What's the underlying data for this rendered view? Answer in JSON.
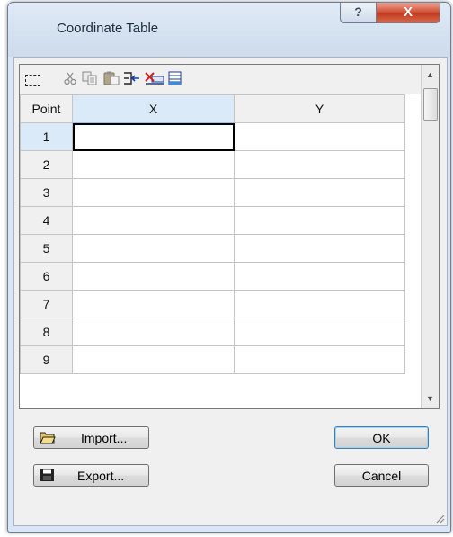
{
  "window": {
    "title": "Coordinate Table",
    "help_label": "?",
    "close_label": "X"
  },
  "toolbar": {
    "items": [
      "select-all-icon",
      "cut-icon",
      "copy-icon",
      "paste-icon",
      "insert-row-icon",
      "delete-row-icon",
      "append-row-icon"
    ]
  },
  "grid": {
    "headers": [
      "Point",
      "X",
      "Y"
    ],
    "rows": [
      {
        "point": "1",
        "x": "",
        "y": ""
      },
      {
        "point": "2",
        "x": "",
        "y": ""
      },
      {
        "point": "3",
        "x": "",
        "y": ""
      },
      {
        "point": "4",
        "x": "",
        "y": ""
      },
      {
        "point": "5",
        "x": "",
        "y": ""
      },
      {
        "point": "6",
        "x": "",
        "y": ""
      },
      {
        "point": "7",
        "x": "",
        "y": ""
      },
      {
        "point": "8",
        "x": "",
        "y": ""
      },
      {
        "point": "9",
        "x": "",
        "y": ""
      }
    ]
  },
  "buttons": {
    "import_label": "Import...",
    "export_label": "Export...",
    "ok_label": "OK",
    "cancel_label": "Cancel"
  },
  "colors": {
    "selection_header": "#daeaf8",
    "close_button": "#c23a1e",
    "window_frame": "#d9e5f2"
  }
}
